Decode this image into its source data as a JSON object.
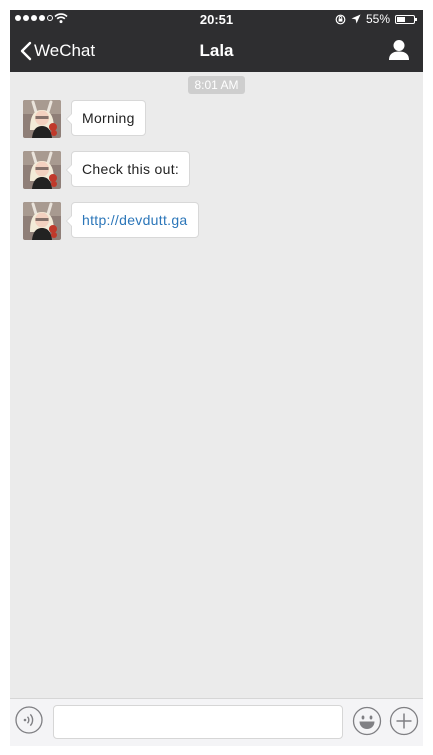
{
  "status_bar": {
    "time": "20:51",
    "battery_text": "55%",
    "battery_level": 0.55,
    "signal_dots_filled": 4,
    "signal_dots_total": 5
  },
  "nav": {
    "back_label": "WeChat",
    "title": "Lala",
    "back_icon": "chevron-left-icon",
    "profile_icon": "person-icon"
  },
  "chat": {
    "timestamp": "8:01 AM",
    "messages": [
      {
        "sender": "Lala",
        "text": "Morning",
        "is_link": false
      },
      {
        "sender": "Lala",
        "text": "Check this out:",
        "is_link": false
      },
      {
        "sender": "Lala",
        "text": "http://devdutt.ga",
        "is_link": true
      }
    ]
  },
  "input_bar": {
    "input_value": "",
    "voice_icon": "voice-icon",
    "emoji_icon": "emoji-icon",
    "plus_icon": "plus-icon"
  },
  "colors": {
    "header_bg": "#2e2e30",
    "chat_bg": "#ebebeb",
    "link": "#2b76b9",
    "timestamp_bg": "#cecece"
  }
}
